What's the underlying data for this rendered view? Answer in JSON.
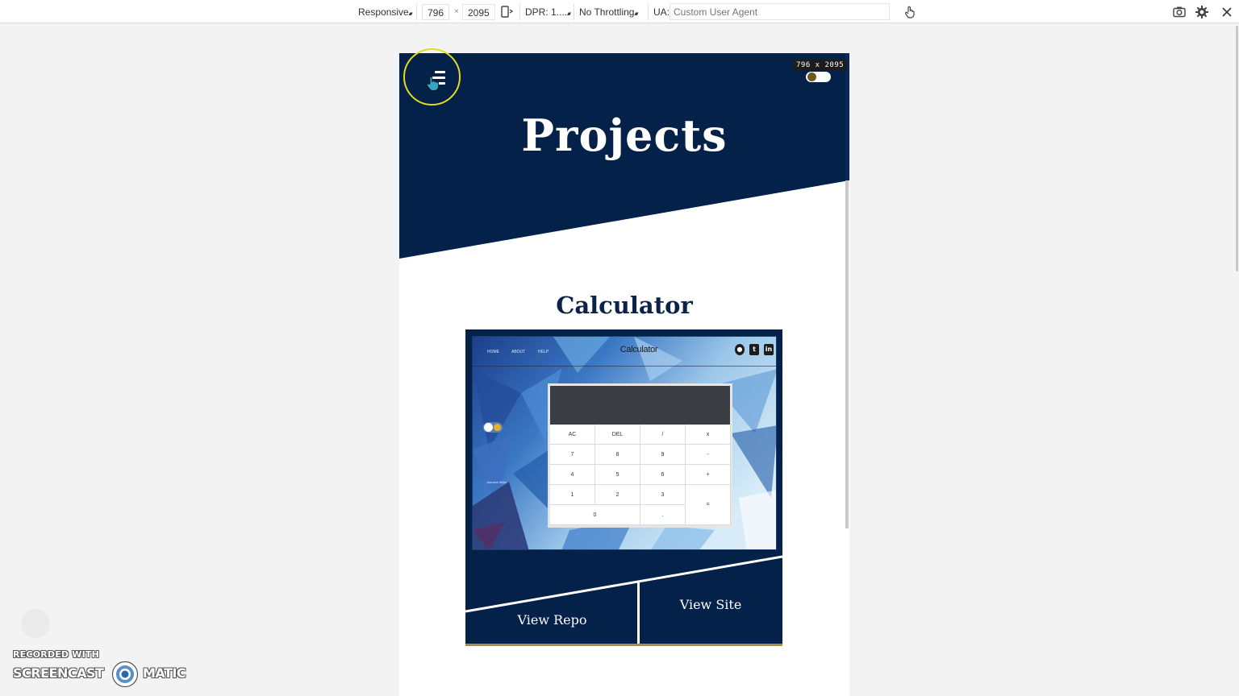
{
  "devtools": {
    "device_mode": "Responsive",
    "width": "796",
    "times": "×",
    "height": "2095",
    "dpr": "DPR: 1....",
    "throttling": "No Throttling",
    "ua_label": "UA:",
    "ua_placeholder": "Custom User Agent",
    "size_badge": "796 x 2095"
  },
  "site": {
    "hero_title": "Projects",
    "colors": {
      "navy": "#04214a",
      "accent_gold": "#a8913c",
      "white": "#ffffff"
    },
    "menu_icon": "hamburger-menu-icon",
    "theme_toggle_icon": "theme-toggle"
  },
  "project": {
    "title": "Calculator",
    "preview": {
      "nav": [
        "HOME",
        "ABOUT",
        "HELP"
      ],
      "title": "Calculator",
      "social_icons": [
        "github-icon",
        "twitter-icon",
        "linkedin-icon"
      ],
      "small_text": "Jasmine Miller",
      "keys": [
        [
          "AC",
          "DEL",
          "/",
          "x"
        ],
        [
          "7",
          "8",
          "9",
          "-"
        ],
        [
          "4",
          "5",
          "6",
          "+"
        ],
        [
          "1",
          "2",
          "3",
          "="
        ],
        [
          "0",
          "."
        ]
      ]
    },
    "view_repo": "View Repo",
    "view_site": "View Site"
  },
  "watermark": {
    "line1": "RECORDED WITH",
    "brand_left": "SCREENCAST",
    "brand_right": "MATIC"
  }
}
